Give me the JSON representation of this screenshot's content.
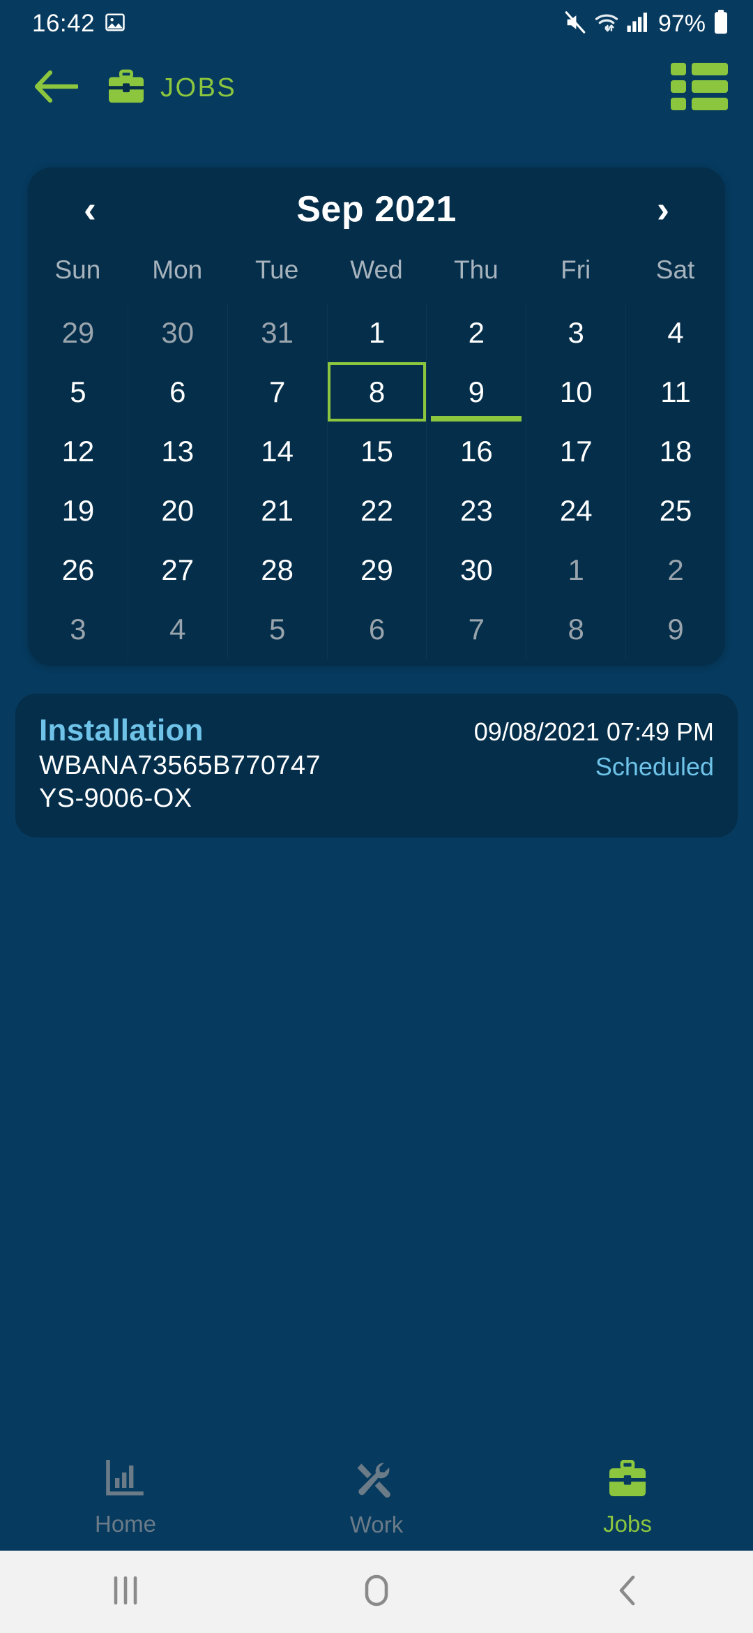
{
  "statusbar": {
    "time": "16:42",
    "battery_percent": "97%",
    "icons": [
      "image-icon",
      "mute-icon",
      "wifi-icon",
      "signal-icon",
      "battery-icon"
    ]
  },
  "toolbar": {
    "back_icon": "arrow-left-icon",
    "title_icon": "briefcase-icon",
    "title": "JOBS",
    "menu_icon": "list-view-icon",
    "accent_color": "#8cc63f"
  },
  "calendar": {
    "prev_label": "‹",
    "next_label": "›",
    "month_label": "Sep 2021",
    "weekdays": [
      "Sun",
      "Mon",
      "Tue",
      "Wed",
      "Thu",
      "Fri",
      "Sat"
    ],
    "selected_day": 8,
    "selection_color": "#8cc63f",
    "days": [
      {
        "label": "29",
        "muted": true,
        "selected": false,
        "hasjob": false
      },
      {
        "label": "30",
        "muted": true,
        "selected": false,
        "hasjob": false
      },
      {
        "label": "31",
        "muted": true,
        "selected": false,
        "hasjob": false
      },
      {
        "label": "1",
        "muted": false,
        "selected": false,
        "hasjob": false
      },
      {
        "label": "2",
        "muted": false,
        "selected": false,
        "hasjob": false
      },
      {
        "label": "3",
        "muted": false,
        "selected": false,
        "hasjob": false
      },
      {
        "label": "4",
        "muted": false,
        "selected": false,
        "hasjob": false
      },
      {
        "label": "5",
        "muted": false,
        "selected": false,
        "hasjob": false
      },
      {
        "label": "6",
        "muted": false,
        "selected": false,
        "hasjob": false
      },
      {
        "label": "7",
        "muted": false,
        "selected": false,
        "hasjob": false
      },
      {
        "label": "8",
        "muted": false,
        "selected": true,
        "hasjob": false
      },
      {
        "label": "9",
        "muted": false,
        "selected": false,
        "hasjob": true
      },
      {
        "label": "10",
        "muted": false,
        "selected": false,
        "hasjob": false
      },
      {
        "label": "11",
        "muted": false,
        "selected": false,
        "hasjob": false
      },
      {
        "label": "12",
        "muted": false,
        "selected": false,
        "hasjob": false
      },
      {
        "label": "13",
        "muted": false,
        "selected": false,
        "hasjob": false
      },
      {
        "label": "14",
        "muted": false,
        "selected": false,
        "hasjob": false
      },
      {
        "label": "15",
        "muted": false,
        "selected": false,
        "hasjob": false
      },
      {
        "label": "16",
        "muted": false,
        "selected": false,
        "hasjob": false
      },
      {
        "label": "17",
        "muted": false,
        "selected": false,
        "hasjob": false
      },
      {
        "label": "18",
        "muted": false,
        "selected": false,
        "hasjob": false
      },
      {
        "label": "19",
        "muted": false,
        "selected": false,
        "hasjob": false
      },
      {
        "label": "20",
        "muted": false,
        "selected": false,
        "hasjob": false
      },
      {
        "label": "21",
        "muted": false,
        "selected": false,
        "hasjob": false
      },
      {
        "label": "22",
        "muted": false,
        "selected": false,
        "hasjob": false
      },
      {
        "label": "23",
        "muted": false,
        "selected": false,
        "hasjob": false
      },
      {
        "label": "24",
        "muted": false,
        "selected": false,
        "hasjob": false
      },
      {
        "label": "25",
        "muted": false,
        "selected": false,
        "hasjob": false
      },
      {
        "label": "26",
        "muted": false,
        "selected": false,
        "hasjob": false
      },
      {
        "label": "27",
        "muted": false,
        "selected": false,
        "hasjob": false
      },
      {
        "label": "28",
        "muted": false,
        "selected": false,
        "hasjob": false
      },
      {
        "label": "29",
        "muted": false,
        "selected": false,
        "hasjob": false
      },
      {
        "label": "30",
        "muted": false,
        "selected": false,
        "hasjob": false
      },
      {
        "label": "1",
        "muted": true,
        "selected": false,
        "hasjob": false
      },
      {
        "label": "2",
        "muted": true,
        "selected": false,
        "hasjob": false
      },
      {
        "label": "3",
        "muted": true,
        "selected": false,
        "hasjob": false
      },
      {
        "label": "4",
        "muted": true,
        "selected": false,
        "hasjob": false
      },
      {
        "label": "5",
        "muted": true,
        "selected": false,
        "hasjob": false
      },
      {
        "label": "6",
        "muted": true,
        "selected": false,
        "hasjob": false
      },
      {
        "label": "7",
        "muted": true,
        "selected": false,
        "hasjob": false
      },
      {
        "label": "8",
        "muted": true,
        "selected": false,
        "hasjob": false
      },
      {
        "label": "9",
        "muted": true,
        "selected": false,
        "hasjob": false
      }
    ]
  },
  "jobs": [
    {
      "type": "Installation",
      "vin": "WBANA73565B770747",
      "reference": "YS-9006-OX",
      "datetime": "09/08/2021 07:49 PM",
      "status": "Scheduled"
    }
  ],
  "bottom_nav": {
    "items": [
      {
        "label": "Home",
        "icon": "bar-chart-icon",
        "active": false
      },
      {
        "label": "Work",
        "icon": "tools-icon",
        "active": false
      },
      {
        "label": "Jobs",
        "icon": "briefcase-icon",
        "active": true
      }
    ],
    "active_color": "#8cc63f",
    "inactive_color": "#6b7b88"
  },
  "android_nav": {
    "recents_icon": "recents-icon",
    "home_icon": "home-circle-icon",
    "back_icon": "back-chevron-icon"
  }
}
